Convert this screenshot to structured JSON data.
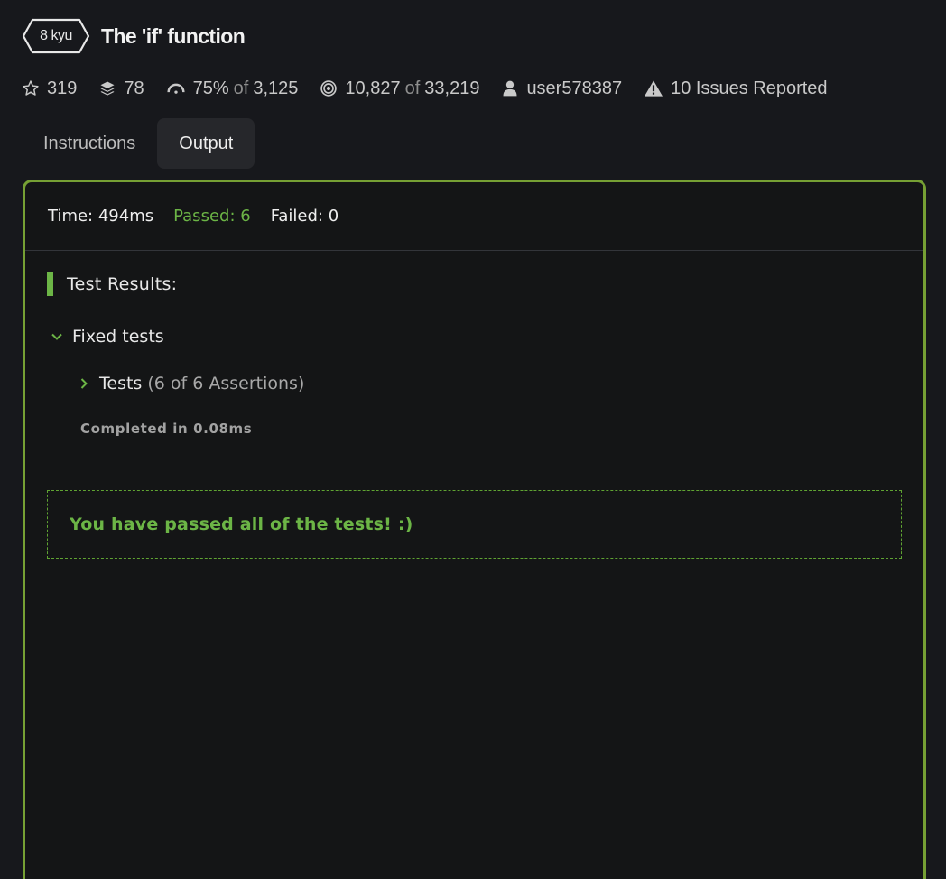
{
  "kata": {
    "rank": "8 kyu",
    "title": "The 'if' function"
  },
  "stats": {
    "stars": "319",
    "collections": "78",
    "satisfaction_pct": "75%",
    "of": "of",
    "satisfaction_votes": "3,125",
    "completed": "10,827",
    "attempted": "33,219",
    "author": "user578387",
    "issues": "10 Issues Reported"
  },
  "tabs": [
    {
      "label": "Instructions",
      "active": false
    },
    {
      "label": "Output",
      "active": true
    }
  ],
  "output": {
    "time": "Time: 494ms",
    "passed": "Passed: 6",
    "failed": "Failed: 0",
    "results_title": "Test Results:",
    "group_label": "Fixed tests",
    "subgroup_label": "Tests",
    "assertions": "(6 of 6 Assertions)",
    "completed_in": "Completed in 0.08ms",
    "success_message": "You have passed all of the tests! :)"
  },
  "icons": {
    "rank": "hexagon-badge-icon",
    "stars": "star-icon",
    "collections": "layers-icon",
    "satisfaction": "gauge-icon",
    "completed": "target-icon",
    "author": "user-icon",
    "issues": "warning-icon",
    "group_toggle": "chevron-down-icon",
    "subgroup_toggle": "chevron-right-icon"
  },
  "colors": {
    "background": "#17181c",
    "accent_green": "#6cb546",
    "panel_border": "#76a034",
    "active_tab": "#26272b"
  }
}
